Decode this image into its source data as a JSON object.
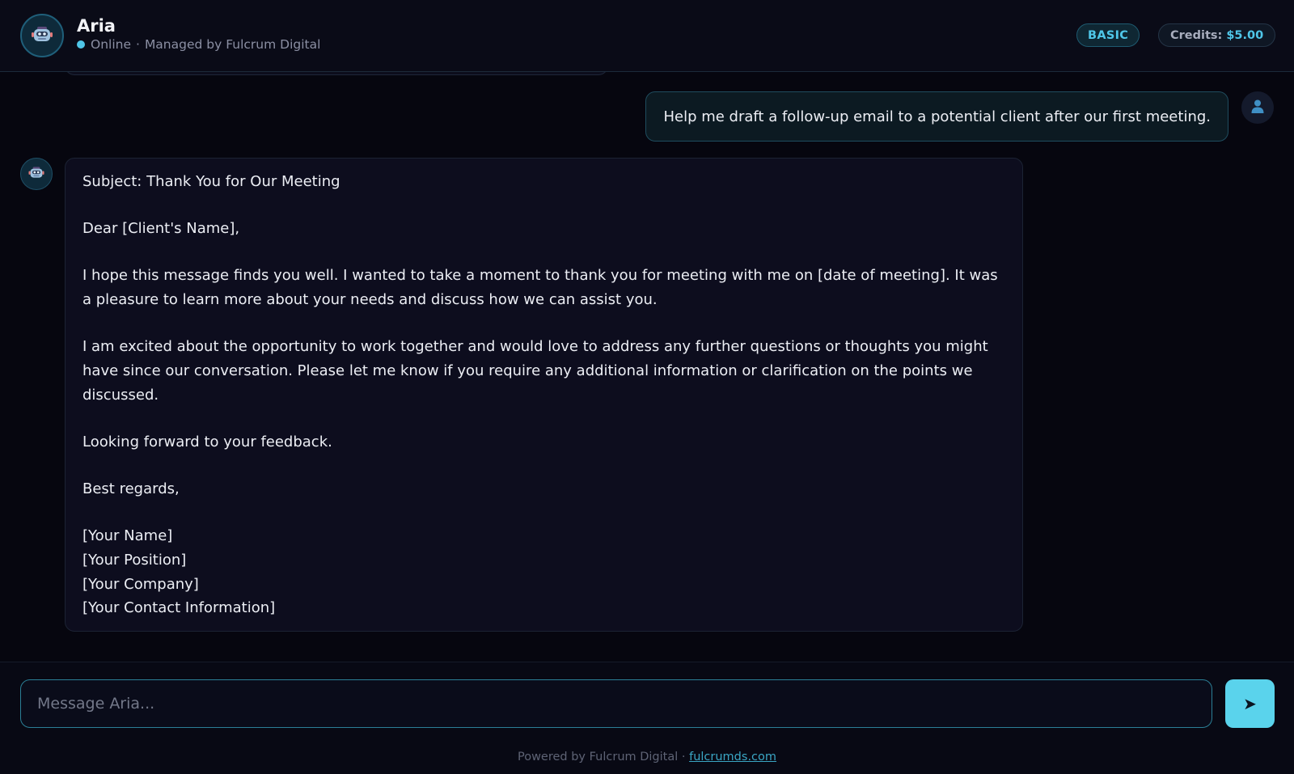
{
  "header": {
    "title": "Aria",
    "status_text": "Online",
    "separator": "·",
    "managed_by": "Managed by Fulcrum Digital",
    "plan_badge": "BASIC",
    "credits_label": "Credits:",
    "credits_value": "$5.00",
    "avatar_icon": "robot-icon"
  },
  "conversation": {
    "user_message": "Help me draft a follow-up email to a potential client after our first meeting.",
    "user_avatar_icon": "user-icon",
    "bot_avatar_icon": "robot-icon",
    "bot_reply": {
      "subject": "Subject: Thank You for Our Meeting",
      "greeting": "Dear [Client's Name],",
      "paragraph_1": "I hope this message finds you well. I wanted to take a moment to thank you for meeting with me on [date of meeting]. It was a pleasure to learn more about your needs and discuss how we can assist you.",
      "paragraph_2": "I am excited about the opportunity to work together and would love to address any further questions or thoughts you might have since our conversation. Please let me know if you require any additional information or clarification on the points we discussed.",
      "closing_line": "Looking forward to your feedback.",
      "sign_off": "Best regards,",
      "signature": [
        "[Your Name]",
        "[Your Position]",
        "[Your Company]",
        "[Your Contact Information]"
      ]
    }
  },
  "composer": {
    "placeholder": "Message Aria...",
    "send_icon": "send-arrow-icon",
    "send_glyph": "➤"
  },
  "footer": {
    "powered_by": "Powered by Fulcrum Digital ·",
    "link_text": "fulcrumds.com"
  },
  "colors": {
    "accent": "#4fc6e8",
    "background": "#06060f",
    "send_button": "#5ad3ec"
  }
}
